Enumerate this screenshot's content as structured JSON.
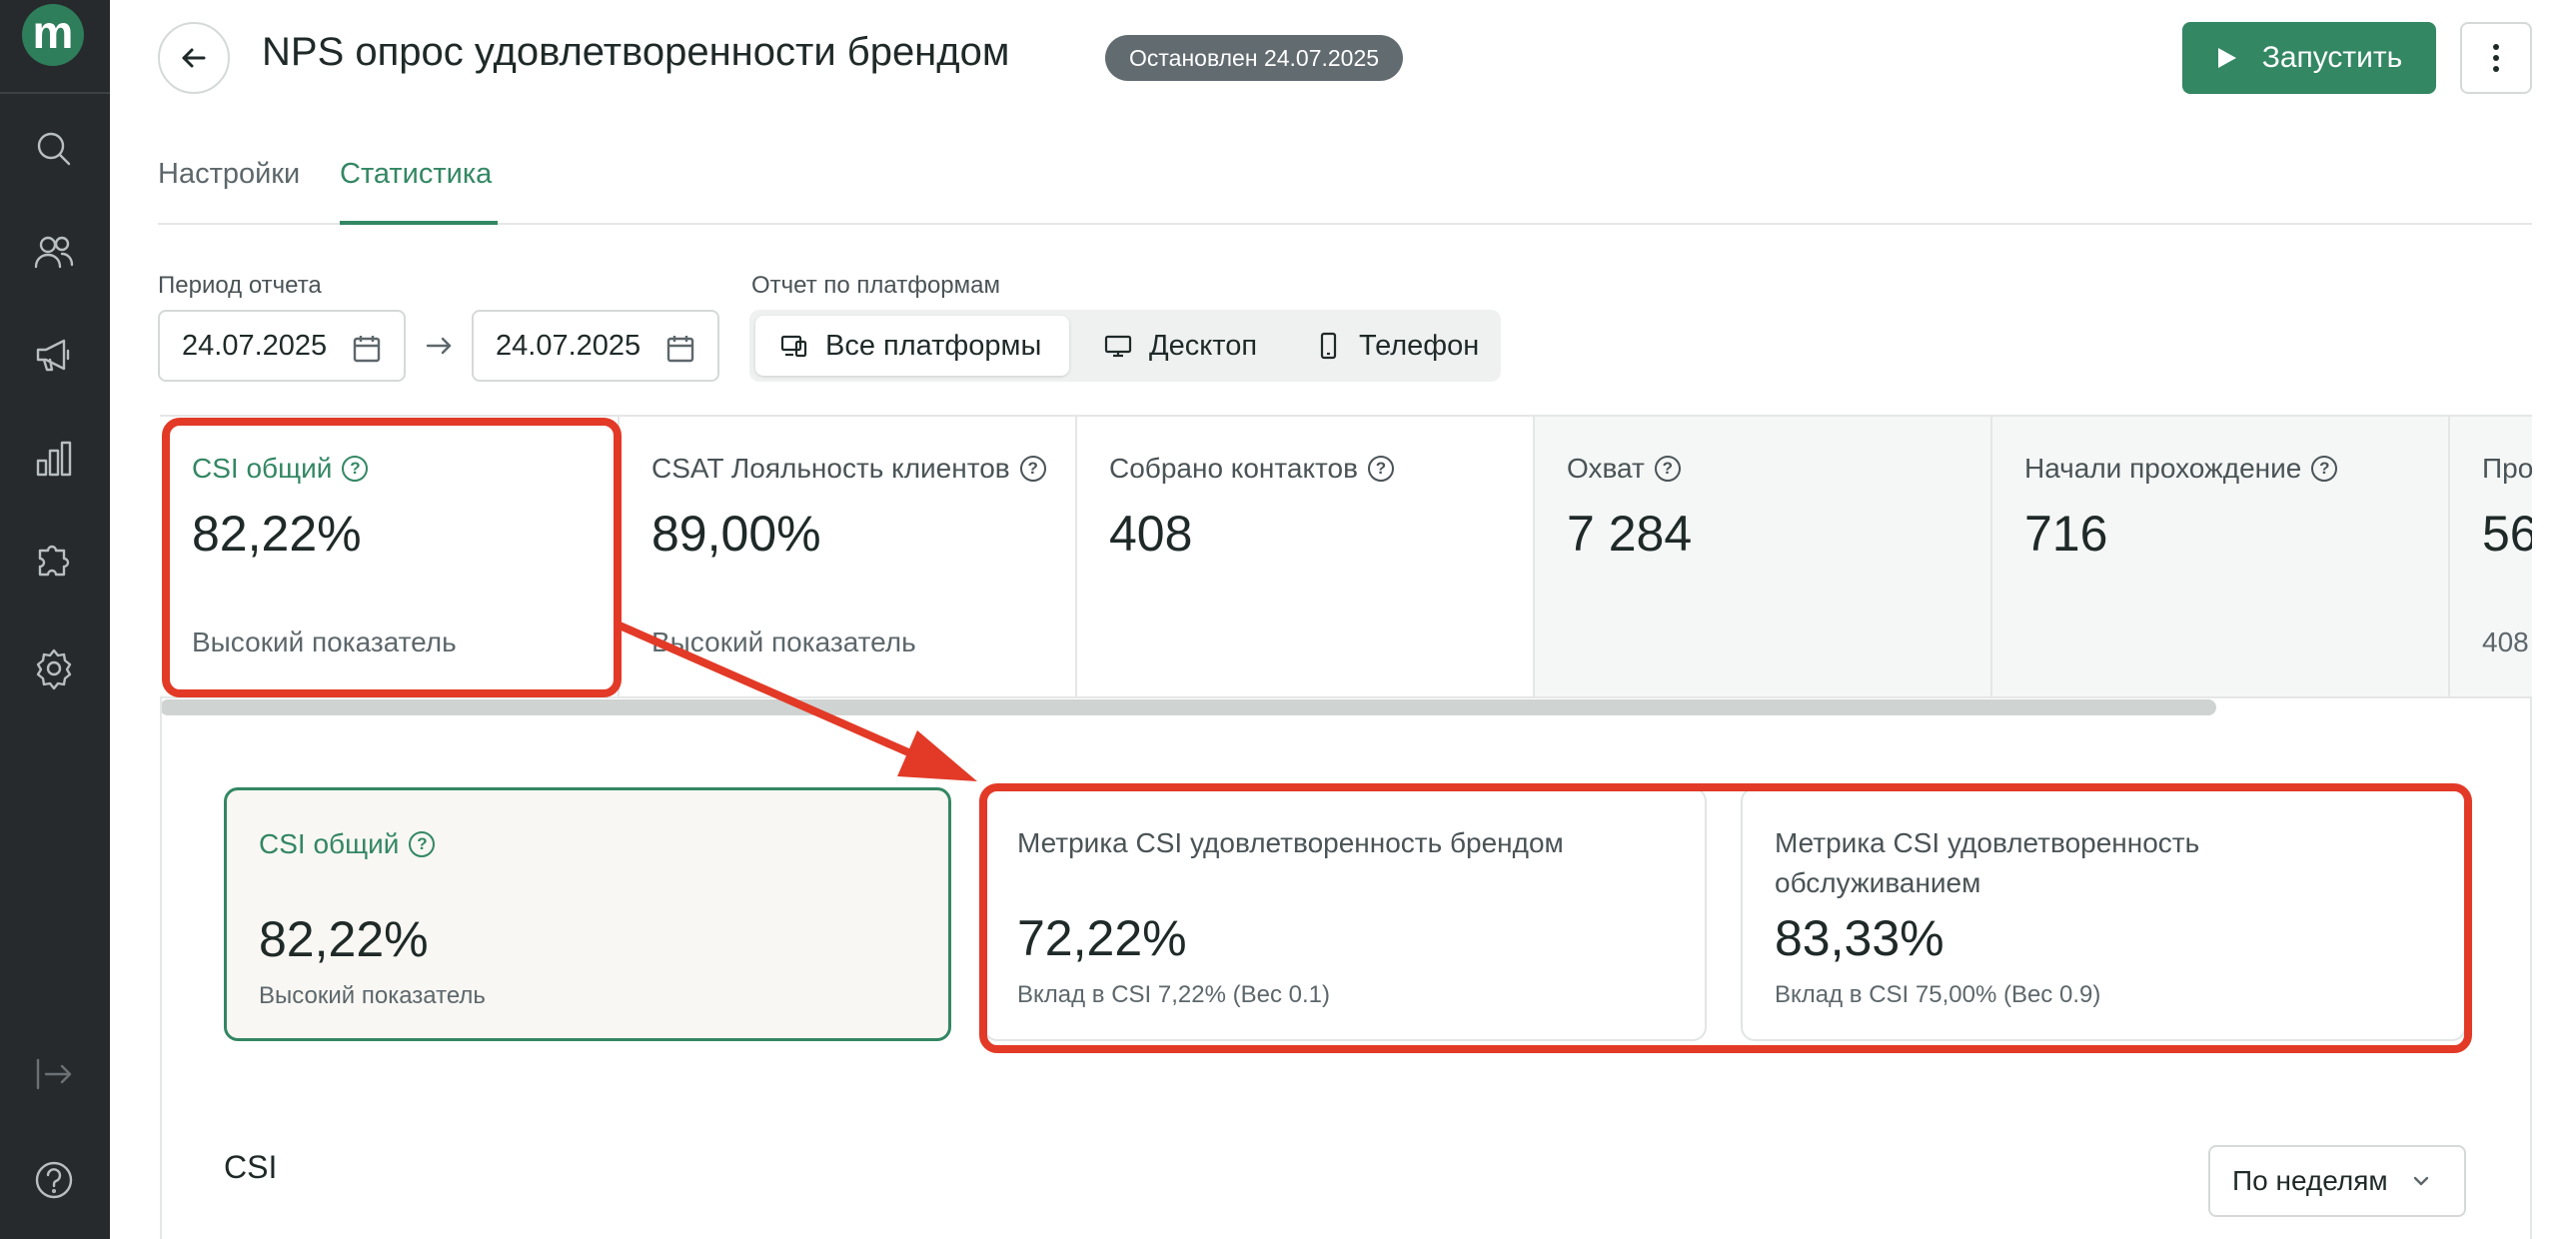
{
  "sidebar": {
    "logo_letter": "m",
    "icons": [
      "search-icon",
      "users-icon",
      "megaphone-icon",
      "chart-icon",
      "puzzle-icon",
      "gear-icon",
      "logout-icon",
      "help-icon"
    ]
  },
  "header": {
    "title": "NPS опрос удовлетворенности брендом",
    "status": "Остановлен 24.07.2025",
    "run_label": "Запустить"
  },
  "tabs": [
    {
      "label": "Настройки",
      "active": false
    },
    {
      "label": "Статистика",
      "active": true
    }
  ],
  "filters": {
    "period_label": "Период отчета",
    "date_from": "24.07.2025",
    "date_to": "24.07.2025",
    "platform_label": "Отчет по платформам",
    "platforms": [
      {
        "label": "Все платформы",
        "active": true
      },
      {
        "label": "Десктоп",
        "active": false
      },
      {
        "label": "Телефон",
        "active": false
      }
    ]
  },
  "metrics": [
    {
      "title": "CSI общий",
      "value": "82,22%",
      "sub": "Высокий показатель"
    },
    {
      "title": "CSAT Лояльность клиентов",
      "value": "89,00%",
      "sub": "Высокий показатель"
    },
    {
      "title": "Собрано контактов",
      "value": "408",
      "sub": ""
    },
    {
      "title": "Охват",
      "value": "7 284",
      "sub": ""
    },
    {
      "title": "Начали прохождение",
      "value": "716",
      "sub": ""
    },
    {
      "title": "Про",
      "value": "56",
      "sub": "408"
    }
  ],
  "details": [
    {
      "title": "CSI общий",
      "value": "82,22%",
      "sub": "Высокий показатель"
    },
    {
      "title": "Метрика CSI удовлетворенность брендом",
      "value": "72,22%",
      "sub": "Вклад в CSI 7,22% (Вес 0.1)"
    },
    {
      "title": "Метрика CSI удовлетворенность обслуживанием",
      "value": "83,33%",
      "sub": "Вклад в CSI 75,00% (Вес 0.9)"
    }
  ],
  "chart_section": {
    "title": "CSI",
    "period_select": "По неделям"
  },
  "colors": {
    "accent": "#338763",
    "sidebar": "#262a2c",
    "annotation": "#e23a27"
  }
}
